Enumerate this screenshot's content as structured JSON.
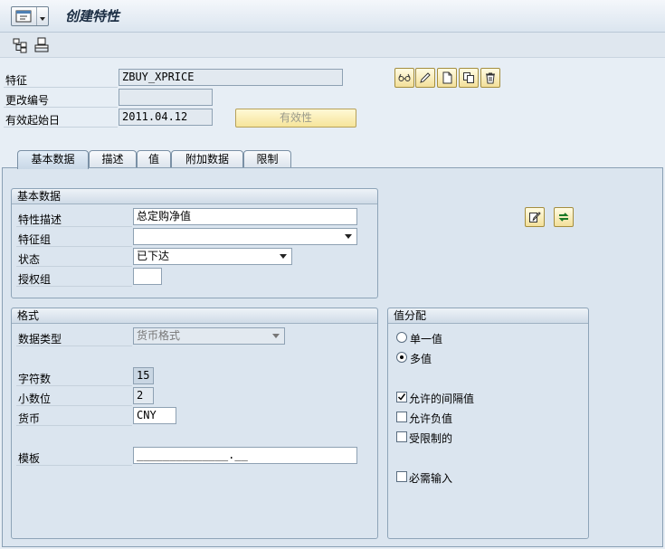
{
  "window": {
    "title": "创建特性"
  },
  "header": {
    "characteristic_label": "特征",
    "characteristic_value": "ZBUY_XPRICE",
    "change_number_label": "更改编号",
    "change_number_value": "",
    "valid_from_label": "有效起始日",
    "valid_from_value": "2011.04.12",
    "validity_button": "有效性"
  },
  "tabs": [
    {
      "label": "基本数据"
    },
    {
      "label": "描述"
    },
    {
      "label": "值"
    },
    {
      "label": "附加数据"
    },
    {
      "label": "限制"
    }
  ],
  "basic_data": {
    "title": "基本数据",
    "description_label": "特性描述",
    "description_value": "总定购净值",
    "chars_group_label": "特征组",
    "chars_group_value": "",
    "status_label": "状态",
    "status_value": "已下达",
    "auth_group_label": "授权组",
    "auth_group_value": ""
  },
  "format": {
    "title": "格式",
    "data_type_label": "数据类型",
    "data_type_value": "货币格式",
    "num_chars_label": "字符数",
    "num_chars_value": "15",
    "decimals_label": "小数位",
    "decimals_value": "2",
    "currency_label": "货币",
    "currency_value": "CNY",
    "template_label": "模板",
    "template_value": "______________.__"
  },
  "value_assignment": {
    "title": "值分配",
    "single_value_label": "单一值",
    "single_value_selected": false,
    "multi_value_label": "多值",
    "multi_value_selected": true,
    "interval_label": "允许的间隔值",
    "interval_checked": true,
    "negative_label": "允许负值",
    "negative_checked": false,
    "restricted_label": "受限制的",
    "restricted_checked": false,
    "required_label": "必需输入",
    "required_checked": false
  },
  "colors": {
    "panel": "#dbe5ef",
    "button_yellow": "#f6e49a",
    "border": "#8ea4b8"
  }
}
